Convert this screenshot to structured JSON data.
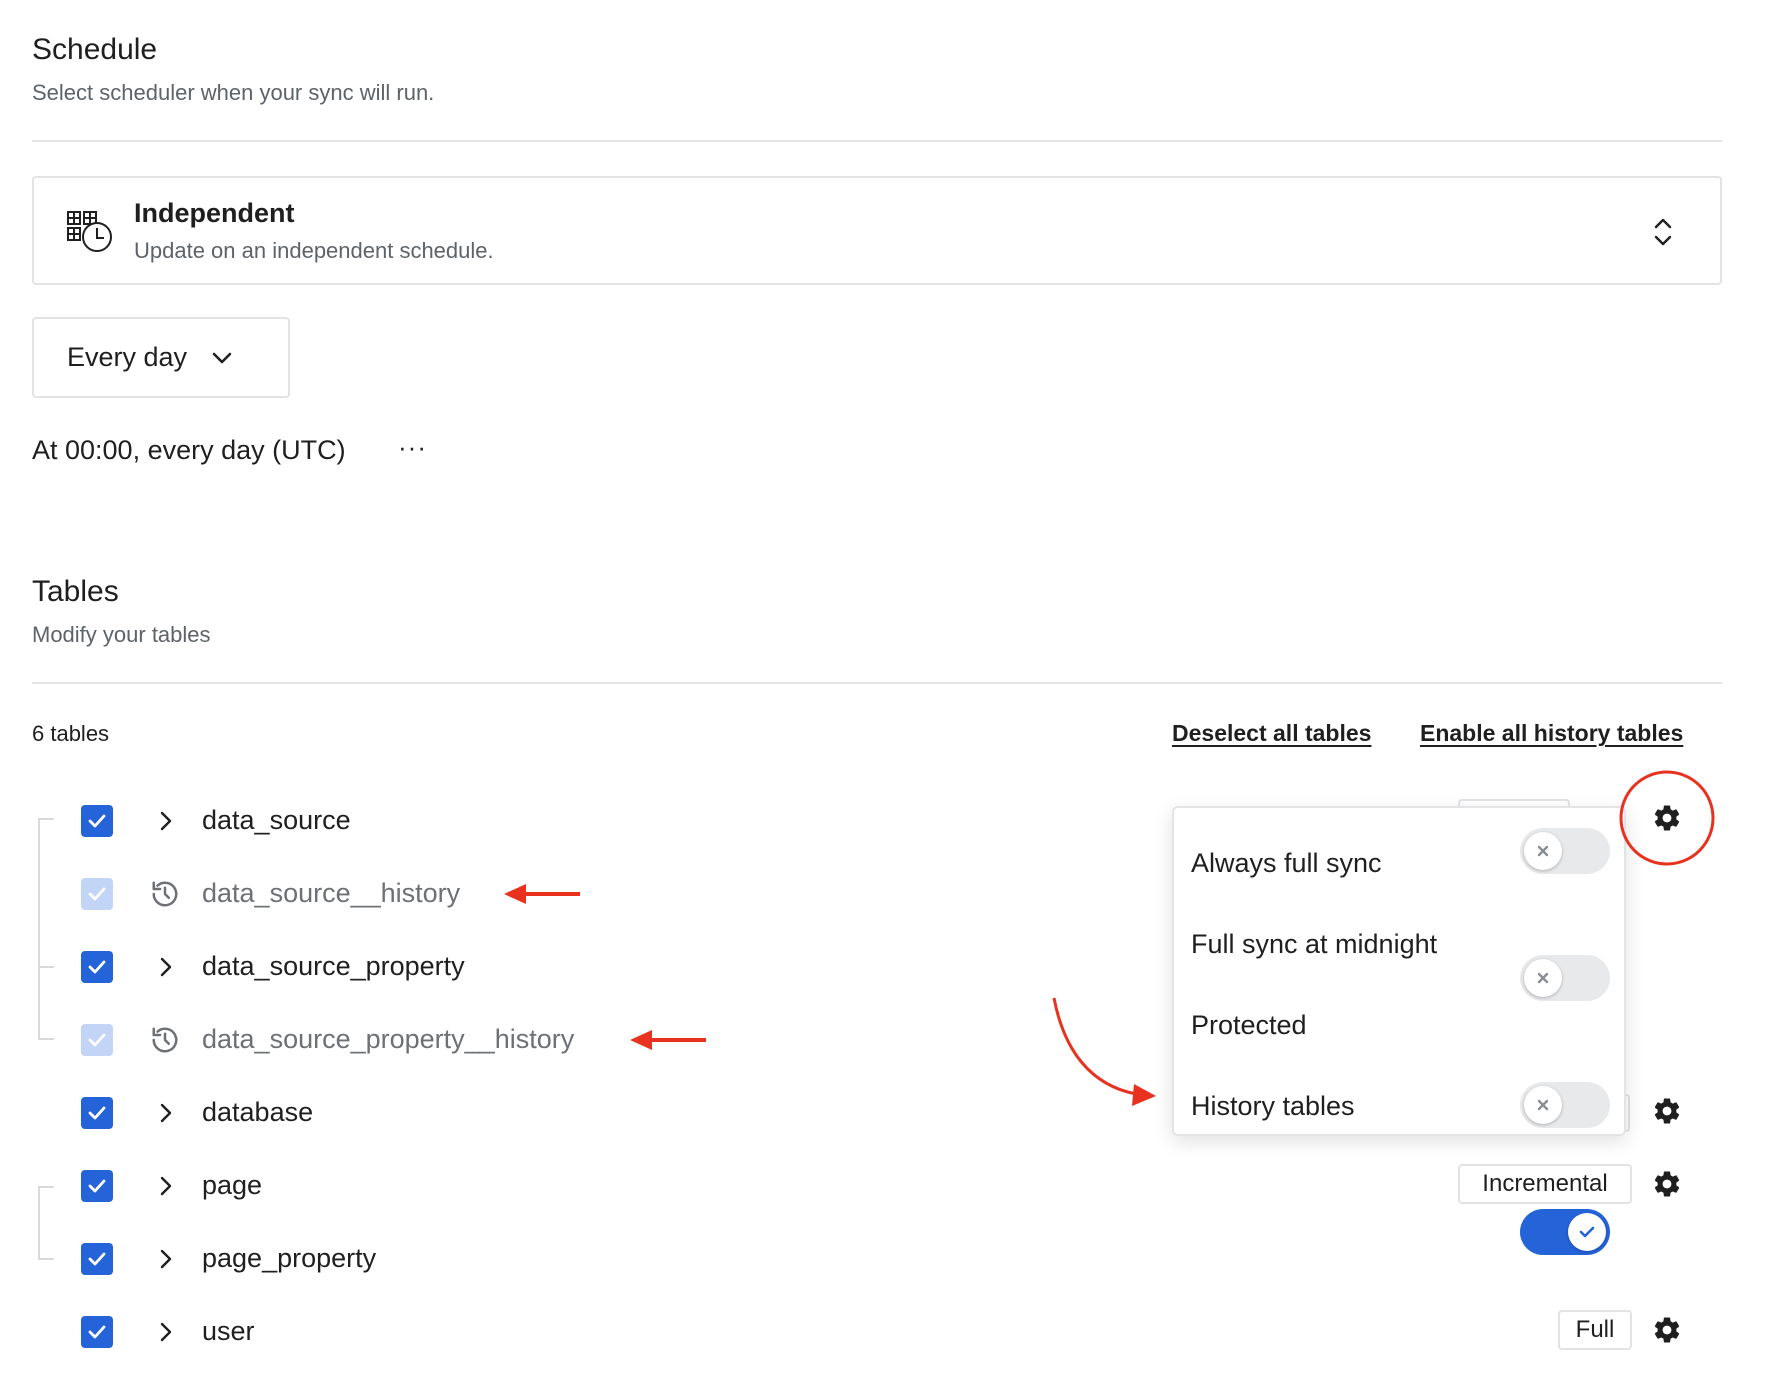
{
  "schedule": {
    "title": "Schedule",
    "subtitle": "Select scheduler when your sync will run.",
    "scheduler": {
      "icon": "grid-clock-icon",
      "title": "Independent",
      "subtitle": "Update on an independent schedule."
    },
    "frequency": "Every day",
    "cron_text": "At 00:00, every day (UTC)",
    "more": "···"
  },
  "tables": {
    "title": "Tables",
    "subtitle": "Modify your tables",
    "count": "6 tables",
    "deselect_all": "Deselect all tables",
    "enable_history": "Enable all history tables",
    "rows": [
      {
        "name": "data_source",
        "checked": true,
        "history": false,
        "mode": "",
        "settings": true
      },
      {
        "name": "data_source__history",
        "checked": true,
        "history": true,
        "mode": "",
        "settings": false
      },
      {
        "name": "data_source_property",
        "checked": true,
        "history": false,
        "mode": "",
        "settings": false
      },
      {
        "name": "data_source_property__history",
        "checked": true,
        "history": true,
        "mode": "",
        "settings": false
      },
      {
        "name": "database",
        "checked": true,
        "history": false,
        "mode": "",
        "settings": true
      },
      {
        "name": "page",
        "checked": true,
        "history": false,
        "mode": "Incremental",
        "settings": true
      },
      {
        "name": "page_property",
        "checked": true,
        "history": false,
        "mode": "",
        "settings": false
      },
      {
        "name": "user",
        "checked": true,
        "history": false,
        "mode": "Full",
        "settings": true
      }
    ]
  },
  "popover": {
    "options": [
      {
        "label": "Always full sync",
        "on": false
      },
      {
        "label": "Full sync at midnight",
        "on": false
      },
      {
        "label": "Protected",
        "on": false
      },
      {
        "label": "History tables",
        "on": true
      }
    ]
  },
  "colors": {
    "accent": "#2563d9",
    "annotation": "#e8321f"
  }
}
